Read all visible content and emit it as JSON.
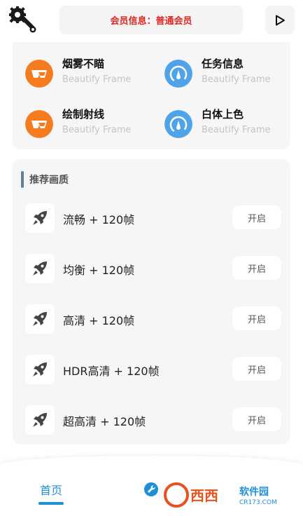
{
  "header": {
    "tool_icon": "wrench-gear-icon",
    "member_info": "会员信息：普通会员",
    "play_icon": "play-icon"
  },
  "features": [
    {
      "title": "烟雾不瞄",
      "subtitle": "Beautify Frame",
      "icon": "goggles-icon",
      "color": "#f47c1f"
    },
    {
      "title": "任务信息",
      "subtitle": "Beautify Frame",
      "icon": "gauge-icon",
      "color": "#4fa3e8"
    },
    {
      "title": "绘制射线",
      "subtitle": "Beautify Frame",
      "icon": "goggles-icon",
      "color": "#f47c1f"
    },
    {
      "title": "白体上色",
      "subtitle": "Beautify Frame",
      "icon": "gauge-icon",
      "color": "#4fa3e8"
    }
  ],
  "quality": {
    "section_title": "推荐画质",
    "items": [
      {
        "label": "流畅 + 120帧",
        "button": "开启"
      },
      {
        "label": "均衡 + 120帧",
        "button": "开启"
      },
      {
        "label": "高清 + 120帧",
        "button": "开启"
      },
      {
        "label": "HDR高清 + 120帧",
        "button": "开启"
      },
      {
        "label": "超高清 + 120帧",
        "button": "开启"
      }
    ]
  },
  "nav": {
    "home_label": "首页",
    "tool_icon": "wrench-icon"
  },
  "watermark": {
    "brand": "西西",
    "name": "软件园",
    "domain": "CR173.COM"
  },
  "colors": {
    "accent": "#1f8fd6",
    "member_text": "#e0261f",
    "orange_icon": "#f47c1f",
    "blue_icon": "#4fa3e8"
  }
}
